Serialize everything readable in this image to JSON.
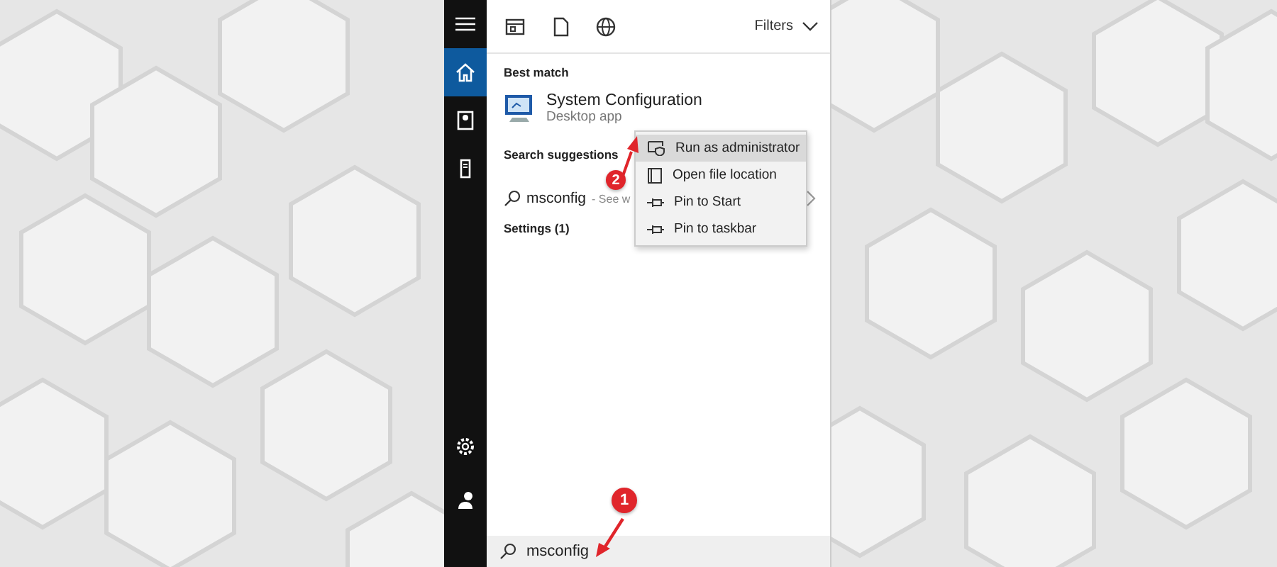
{
  "sidebar": {
    "items": [
      {
        "selected": false
      },
      {
        "selected": true
      },
      {
        "selected": false
      },
      {
        "selected": false
      }
    ]
  },
  "toolbar": {
    "filters": "Filters"
  },
  "best_match": {
    "heading": "Best match",
    "title": "System Configuration",
    "subtitle": "Desktop app"
  },
  "search_suggestions": {
    "heading": "Search suggestions",
    "query": "msconfig",
    "hint": "- See w"
  },
  "settings_heading": "Settings (1)",
  "context_menu": [
    {
      "label": "Run as administrator",
      "selected": true
    },
    {
      "label": "Open file location",
      "selected": false
    },
    {
      "label": "Pin to Start",
      "selected": false
    },
    {
      "label": "Pin to taskbar",
      "selected": false
    }
  ],
  "search_box": {
    "value": "msconfig"
  },
  "annotations": [
    {
      "number": "1"
    },
    {
      "number": "2"
    }
  ]
}
